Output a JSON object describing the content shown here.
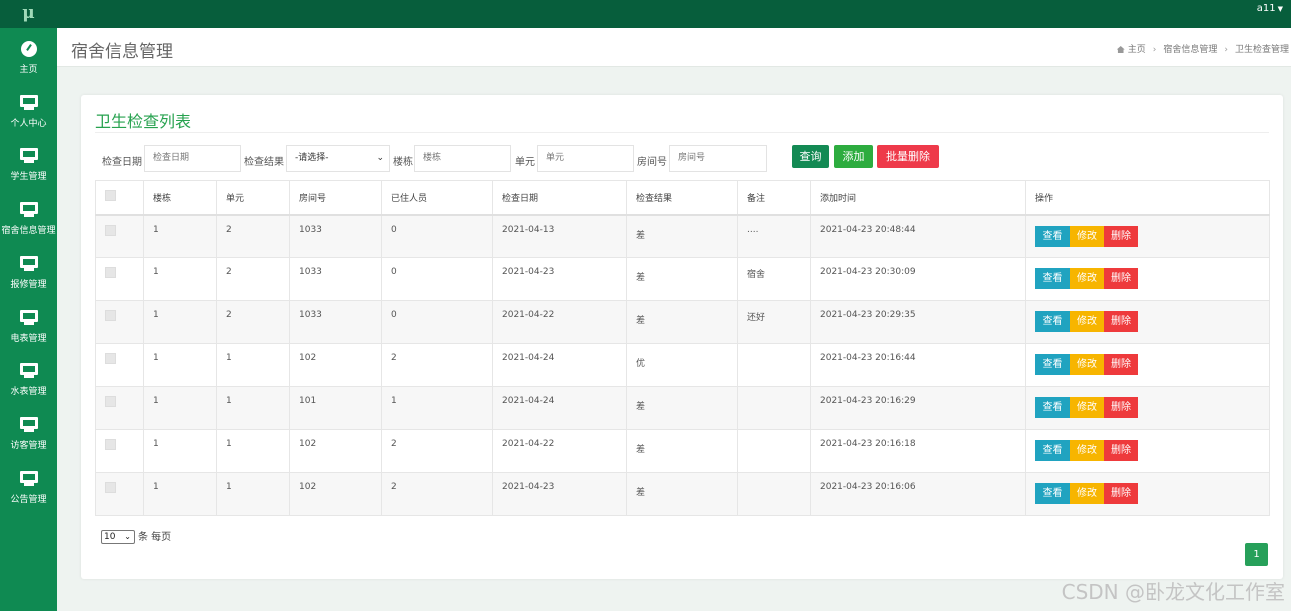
{
  "app": {
    "logo": "μ",
    "user": "a11"
  },
  "sidebar": {
    "items": [
      {
        "label": "主页",
        "icon": "dashboard-icon"
      },
      {
        "label": "个人中心",
        "icon": "monitor-icon"
      },
      {
        "label": "学生管理",
        "icon": "monitor-icon"
      },
      {
        "label": "宿舍信息管理",
        "icon": "monitor-icon"
      },
      {
        "label": "报修管理",
        "icon": "monitor-icon"
      },
      {
        "label": "电表管理",
        "icon": "monitor-icon"
      },
      {
        "label": "水表管理",
        "icon": "monitor-icon"
      },
      {
        "label": "访客管理",
        "icon": "monitor-icon"
      },
      {
        "label": "公告管理",
        "icon": "monitor-icon"
      }
    ]
  },
  "header": {
    "title": "宿舍信息管理",
    "breadcrumb": [
      "主页",
      "宿舍信息管理",
      "卫生检查管理"
    ]
  },
  "card": {
    "title": "卫生检查列表"
  },
  "filter": {
    "date_label": "检查日期",
    "date_placeholder": "检查日期",
    "result_label": "检查结果",
    "result_value": "-请选择-",
    "building_label": "楼栋",
    "building_placeholder": "楼栋",
    "unit_label": "单元",
    "unit_placeholder": "单元",
    "room_label": "房间号",
    "room_placeholder": "房间号",
    "search_btn": "查询",
    "add_btn": "添加",
    "batch_delete_btn": "批量删除"
  },
  "table": {
    "headers": [
      "楼栋",
      "单元",
      "房间号",
      "已住人员",
      "检查日期",
      "检查结果",
      "备注",
      "添加时间",
      "操作"
    ],
    "actions": {
      "view": "查看",
      "edit": "修改",
      "delete": "删除"
    },
    "rows": [
      [
        "1",
        "2",
        "1033",
        "0",
        "2021-04-13",
        "差",
        "....",
        "2021-04-23 20:48:44"
      ],
      [
        "1",
        "2",
        "1033",
        "0",
        "2021-04-23",
        "差",
        "宿舍",
        "2021-04-23 20:30:09"
      ],
      [
        "1",
        "2",
        "1033",
        "0",
        "2021-04-22",
        "差",
        "还好",
        "2021-04-23 20:29:35"
      ],
      [
        "1",
        "1",
        "102",
        "2",
        "2021-04-24",
        "优",
        "",
        "2021-04-23 20:16:44"
      ],
      [
        "1",
        "1",
        "101",
        "1",
        "2021-04-24",
        "差",
        "",
        "2021-04-23 20:16:29"
      ],
      [
        "1",
        "1",
        "102",
        "2",
        "2021-04-22",
        "差",
        "",
        "2021-04-23 20:16:18"
      ],
      [
        "1",
        "1",
        "102",
        "2",
        "2021-04-23",
        "差",
        "",
        "2021-04-23 20:16:06"
      ]
    ]
  },
  "pagination": {
    "page_size": "10",
    "page_size_suffix": "条 每页",
    "current_page": "1"
  },
  "watermark": "CSDN @卧龙文化工作室",
  "colors": {
    "topbar": "#075e3c",
    "sidebar": "#0f8a52",
    "title": "#27a24f",
    "view": "#20a3c0",
    "edit": "#f7b500",
    "delete": "#ee3a3c"
  }
}
